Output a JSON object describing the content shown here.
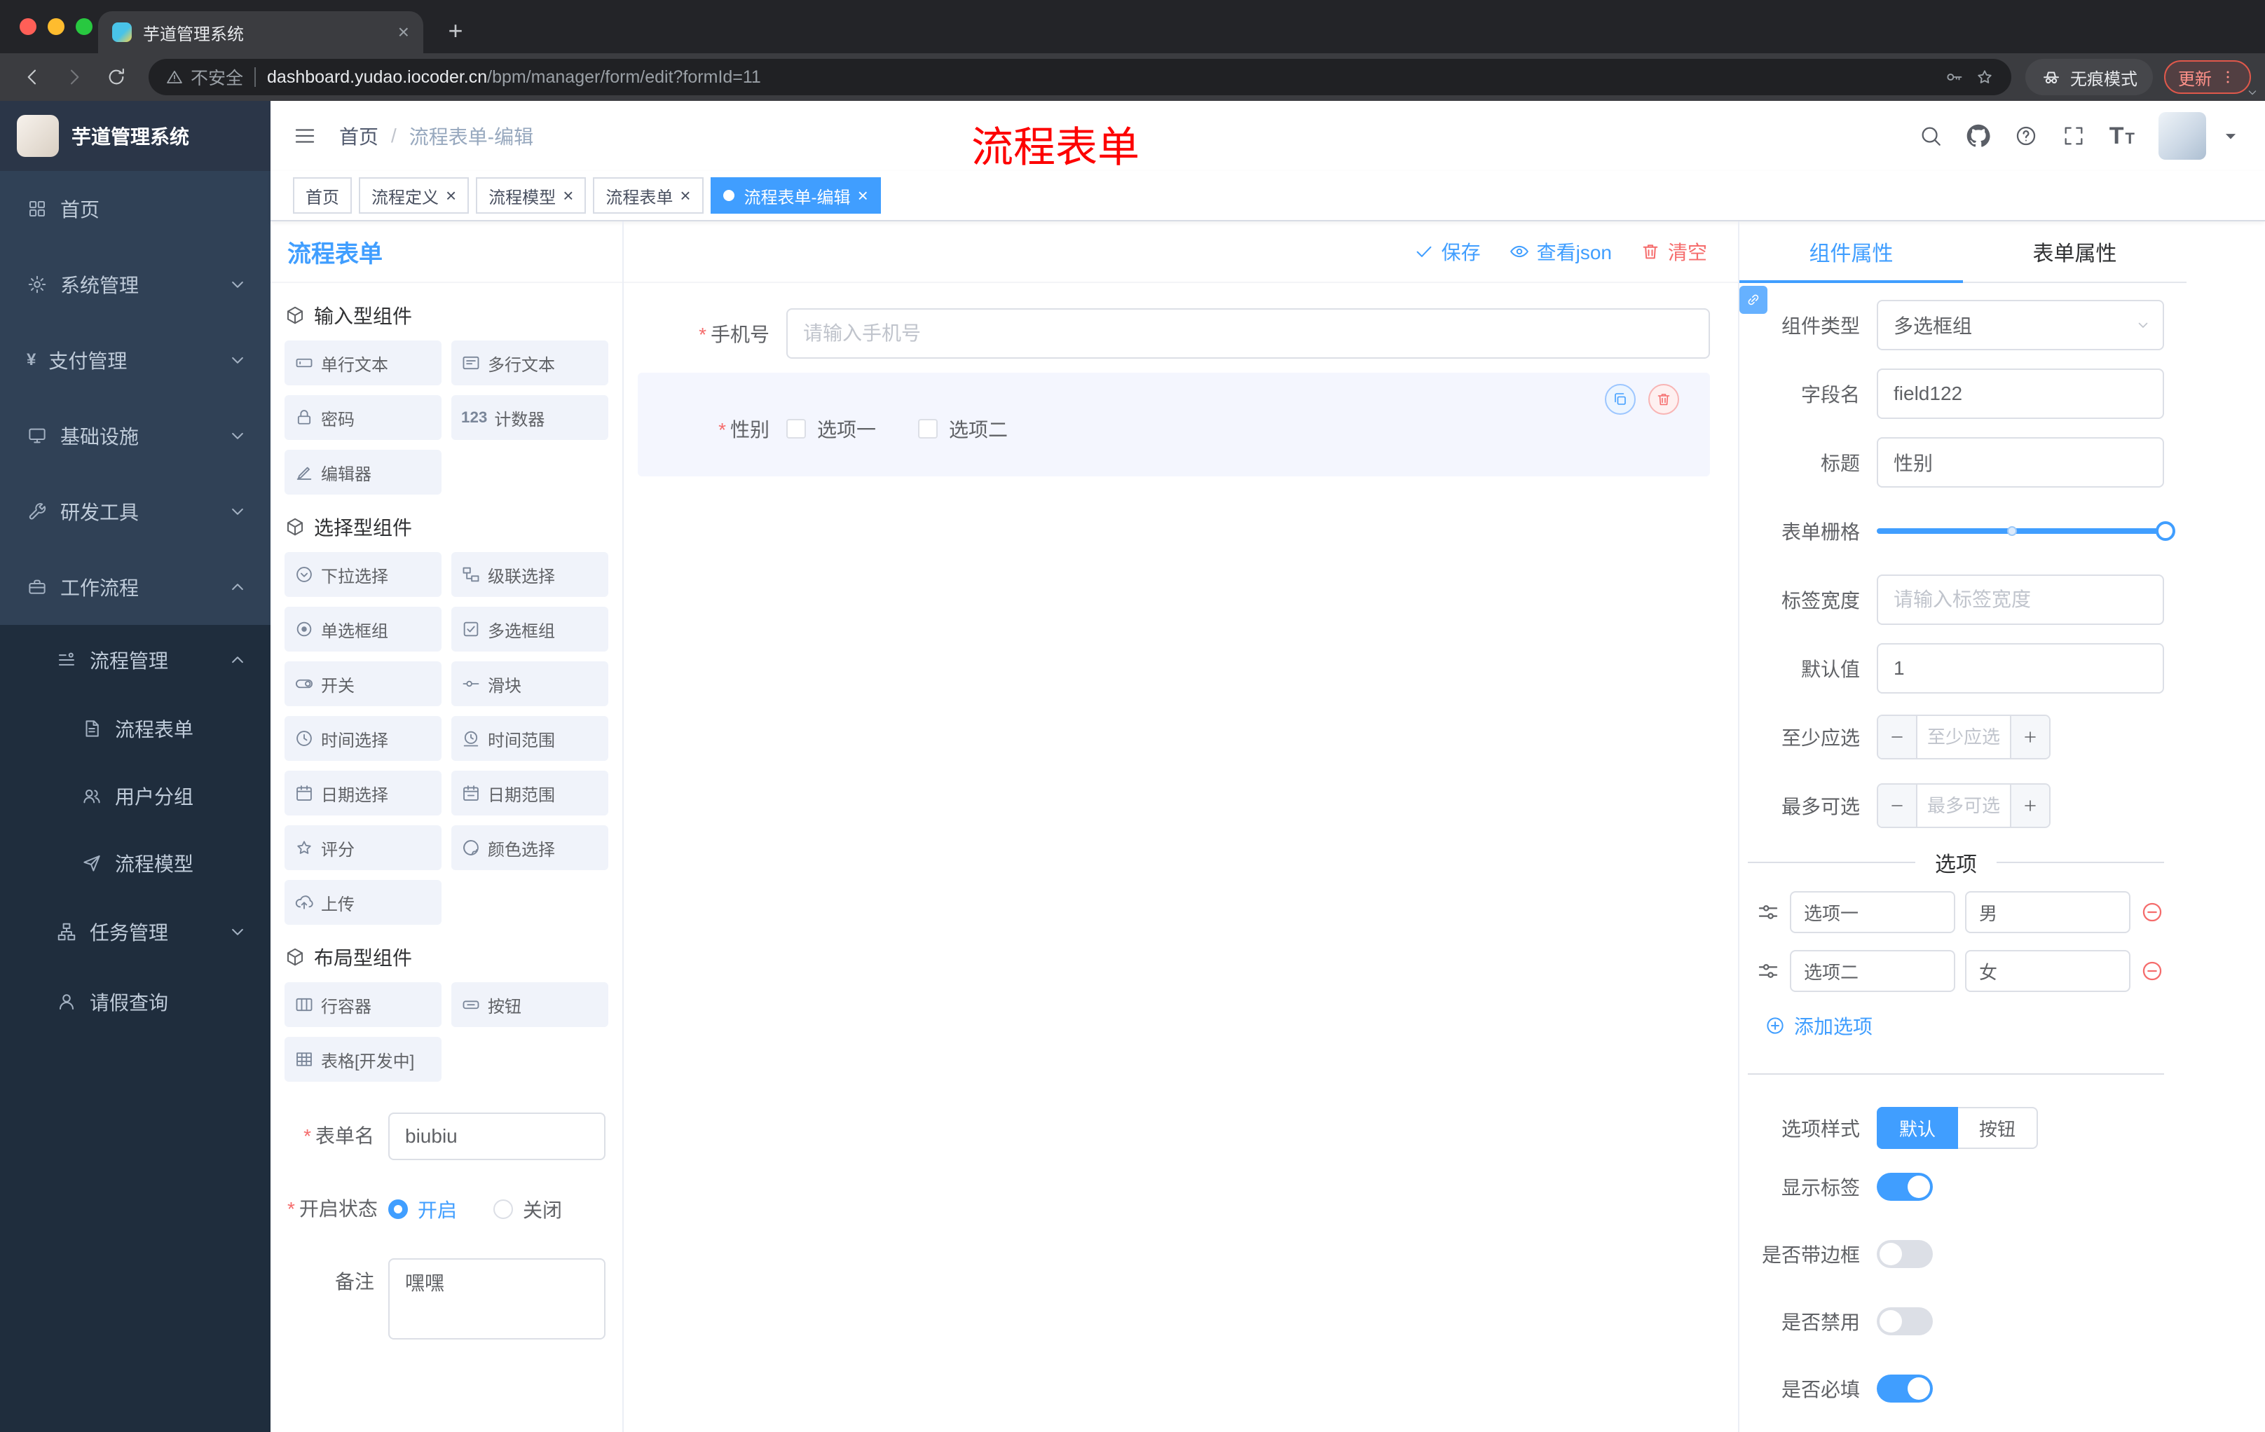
{
  "colors": {
    "accent": "#409EFF",
    "danger": "#F56C6C",
    "sidebar_bg": "#304156",
    "submenu_bg": "#1F2D3D",
    "active_tag": "#409EFF",
    "annotation": "#FD0000"
  },
  "browser": {
    "tab_title": "芋道管理系统",
    "security_text": "不安全",
    "url_host": "dashboard.yudao.iocoder.cn",
    "url_path": "/bpm/manager/form/edit?formId=11",
    "incognito_label": "无痕模式",
    "update_label": "更新"
  },
  "header": {
    "breadcrumb": [
      "首页",
      "流程表单-编辑"
    ],
    "breadcrumb_separator": "/",
    "annotation": "流程表单"
  },
  "sidebar": {
    "logo_title": "芋道管理系统",
    "items": [
      {
        "id": "home",
        "label": "首页",
        "icon": "dashboard",
        "level": 1
      },
      {
        "id": "system",
        "label": "系统管理",
        "icon": "gear",
        "level": 1,
        "chevron": "down"
      },
      {
        "id": "payment",
        "label": "支付管理",
        "icon": "yen",
        "level": 1,
        "chevron": "down"
      },
      {
        "id": "infra",
        "label": "基础设施",
        "icon": "monitor",
        "level": 1,
        "chevron": "down"
      },
      {
        "id": "devtools",
        "label": "研发工具",
        "icon": "wrench",
        "level": 1,
        "chevron": "down"
      },
      {
        "id": "workflow",
        "label": "工作流程",
        "icon": "briefcase",
        "level": 1,
        "chevron": "up"
      },
      {
        "id": "process-manage",
        "label": "流程管理",
        "icon": "flow",
        "level": 2,
        "chevron": "up"
      },
      {
        "id": "process-form",
        "label": "流程表单",
        "icon": "doc",
        "level": 3
      },
      {
        "id": "user-group",
        "label": "用户分组",
        "icon": "users",
        "level": 3
      },
      {
        "id": "process-model",
        "label": "流程模型",
        "icon": "send",
        "level": 3
      },
      {
        "id": "task-manage",
        "label": "任务管理",
        "icon": "tree",
        "level": 2,
        "chevron": "down"
      },
      {
        "id": "leave-query",
        "label": "请假查询",
        "icon": "person",
        "level": 2
      }
    ]
  },
  "tags": [
    {
      "label": "首页",
      "closable": false,
      "active": false
    },
    {
      "label": "流程定义",
      "closable": true,
      "active": false
    },
    {
      "label": "流程模型",
      "closable": true,
      "active": false
    },
    {
      "label": "流程表单",
      "closable": true,
      "active": false
    },
    {
      "label": "流程表单-编辑",
      "closable": true,
      "active": true
    }
  ],
  "designer": {
    "panel_title": "流程表单",
    "toolbar": {
      "save": "保存",
      "view_json": "查看json",
      "clear": "清空"
    },
    "palette": [
      {
        "title": "输入型组件",
        "items": [
          {
            "label": "单行文本",
            "icon": "field-input"
          },
          {
            "label": "多行文本",
            "icon": "field-textarea"
          },
          {
            "label": "密码",
            "icon": "field-password"
          },
          {
            "label": "计数器",
            "icon": "field-counter"
          },
          {
            "label": "编辑器",
            "icon": "field-editor"
          }
        ]
      },
      {
        "title": "选择型组件",
        "items": [
          {
            "label": "下拉选择",
            "icon": "field-select"
          },
          {
            "label": "级联选择",
            "icon": "field-cascader"
          },
          {
            "label": "单选框组",
            "icon": "field-radio"
          },
          {
            "label": "多选框组",
            "icon": "field-checkbox"
          },
          {
            "label": "开关",
            "icon": "field-switch"
          },
          {
            "label": "滑块",
            "icon": "field-slider"
          },
          {
            "label": "时间选择",
            "icon": "field-time"
          },
          {
            "label": "时间范围",
            "icon": "field-time-range"
          },
          {
            "label": "日期选择",
            "icon": "field-date"
          },
          {
            "label": "日期范围",
            "icon": "field-date-range"
          },
          {
            "label": "评分",
            "icon": "field-rate"
          },
          {
            "label": "颜色选择",
            "icon": "field-color"
          },
          {
            "label": "上传",
            "icon": "field-upload"
          }
        ]
      },
      {
        "title": "布局型组件",
        "items": [
          {
            "label": "行容器",
            "icon": "field-row"
          },
          {
            "label": "按钮",
            "icon": "field-button"
          },
          {
            "label": "表格[开发中]",
            "icon": "field-table"
          }
        ]
      }
    ],
    "meta": {
      "name_label": "表单名",
      "name_value": "biubiu",
      "status_label": "开启状态",
      "status_options": [
        "开启",
        "关闭"
      ],
      "status_value": "开启",
      "remark_label": "备注",
      "remark_value": "嘿嘿"
    },
    "canvas": {
      "phone": {
        "label": "手机号",
        "placeholder": "请输入手机号",
        "required": true
      },
      "gender": {
        "label": "性别",
        "required": true,
        "options": [
          "选项一",
          "选项二"
        ],
        "selected": true
      }
    }
  },
  "properties": {
    "tabs": [
      "组件属性",
      "表单属性"
    ],
    "active_tab": "组件属性",
    "component_type_label": "组件类型",
    "component_type_value": "多选框组",
    "field_name_label": "字段名",
    "field_name_value": "field122",
    "title_label": "标题",
    "title_value": "性别",
    "grid_label": "表单栅格",
    "label_width_label": "标签宽度",
    "label_width_placeholder": "请输入标签宽度",
    "default_label": "默认值",
    "default_value": "1",
    "min_label": "至少应选",
    "min_placeholder": "至少应选",
    "max_label": "最多可选",
    "max_placeholder": "最多可选",
    "options_title": "选项",
    "options": [
      {
        "label": "选项一",
        "value": "男"
      },
      {
        "label": "选项二",
        "value": "女"
      }
    ],
    "add_option_label": "添加选项",
    "style_label": "选项样式",
    "style_options": [
      "默认",
      "按钮"
    ],
    "style_value": "默认",
    "switches": [
      {
        "label": "显示标签",
        "on": true
      },
      {
        "label": "是否带边框",
        "on": false
      },
      {
        "label": "是否禁用",
        "on": false
      },
      {
        "label": "是否必填",
        "on": true
      }
    ]
  }
}
